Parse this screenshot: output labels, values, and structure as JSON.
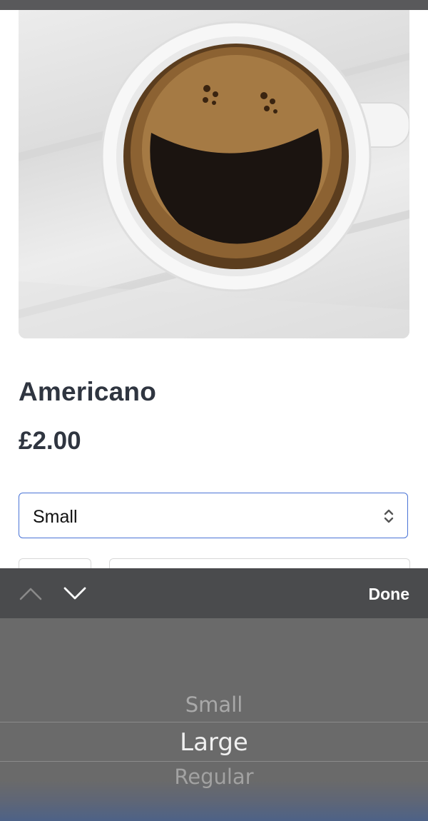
{
  "product": {
    "image": {
      "subject": "coffee-cup-smiley"
    },
    "name": "Americano",
    "price": "£2.00"
  },
  "size_select": {
    "selected": "Small",
    "options": [
      "Small",
      "Large",
      "Regular"
    ]
  },
  "picker": {
    "done_label": "Done",
    "prev_icon": "chevron-up-icon",
    "next_icon": "chevron-down-icon",
    "options": [
      "Small",
      "Large",
      "Regular"
    ],
    "highlighted": "Large"
  },
  "colors": {
    "select_border": "#4a74d6",
    "toolbar_bg": "#4a4b4d",
    "picker_bg": "#6a6a6a",
    "text_dark": "#2f3540"
  }
}
